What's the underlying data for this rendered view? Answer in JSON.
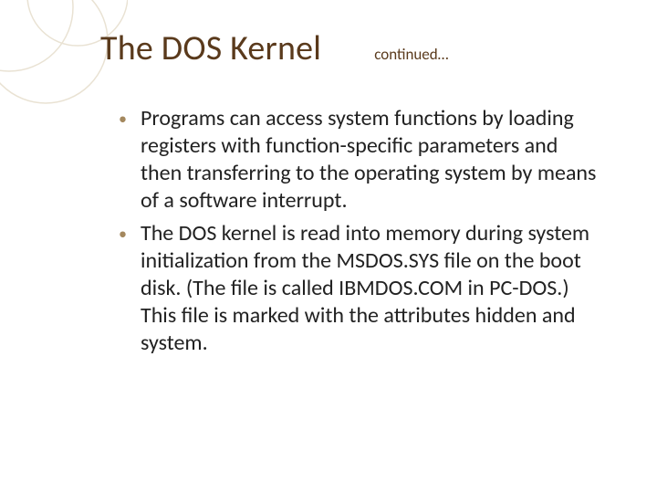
{
  "title": "The DOS Kernel",
  "continued": "continued…",
  "bullets": [
    "Programs can access system functions by loading registers with function-specific parameters and then transferring to the operating system by means of a software interrupt.",
    "The DOS kernel is read into memory during system initialization from the MSDOS.SYS file on the boot disk. (The file is called IBMDOS.COM in PC-DOS.) This file is marked with the attributes hidden and system."
  ]
}
